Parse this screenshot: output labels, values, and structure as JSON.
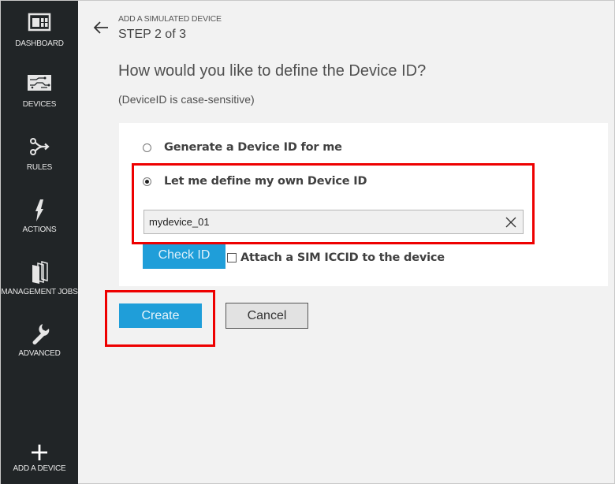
{
  "sidebar": {
    "items": [
      {
        "label": "DASHBOARD",
        "icon": "dashboard-icon"
      },
      {
        "label": "DEVICES",
        "icon": "devices-icon"
      },
      {
        "label": "RULES",
        "icon": "rules-icon"
      },
      {
        "label": "ACTIONS",
        "icon": "lightning-icon"
      },
      {
        "label": "MANAGEMENT JOBS",
        "icon": "jobs-icon"
      },
      {
        "label": "ADVANCED",
        "icon": "wrench-icon"
      }
    ],
    "add_device": {
      "label": "ADD A DEVICE",
      "icon": "plus-icon"
    }
  },
  "header": {
    "breadcrumb": "ADD A SIMULATED DEVICE",
    "step": "STEP 2 of 3"
  },
  "form": {
    "question": "How would you like to define the Device ID?",
    "hint": "(DeviceID is case-sensitive)",
    "options": [
      {
        "label": "Generate a Device ID for me",
        "selected": false
      },
      {
        "label": "Let me define my own Device ID",
        "selected": true
      }
    ],
    "device_id_value": "mydevice_01",
    "check_id_label": "Check ID",
    "sim_checkbox_label": "Attach a SIM ICCID to the device",
    "sim_checked": false
  },
  "actions": {
    "create_label": "Create",
    "cancel_label": "Cancel"
  },
  "colors": {
    "sidebar_bg": "#212527",
    "accent": "#1f9ed9",
    "highlight": "#ee0000",
    "page_bg": "#f2f2f2"
  }
}
